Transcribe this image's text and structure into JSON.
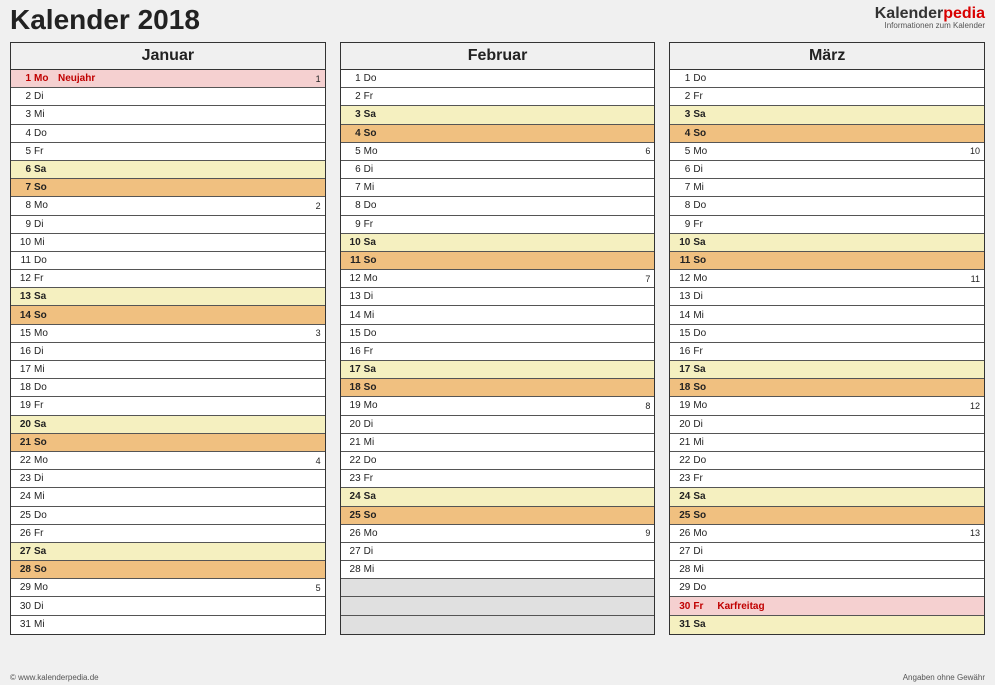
{
  "title": "Kalender 2018",
  "brand": {
    "name1": "Kalender",
    "name2": "pedia",
    "sub": "Informationen zum Kalender"
  },
  "footer": {
    "left": "© www.kalenderpedia.de",
    "right": "Angaben ohne Gewähr"
  },
  "months": [
    {
      "name": "Januar",
      "days": [
        {
          "n": "1",
          "wd": "Mo",
          "note": "Neujahr",
          "wk": "1",
          "cls": "holiday"
        },
        {
          "n": "2",
          "wd": "Di",
          "note": "",
          "wk": "",
          "cls": ""
        },
        {
          "n": "3",
          "wd": "Mi",
          "note": "",
          "wk": "",
          "cls": ""
        },
        {
          "n": "4",
          "wd": "Do",
          "note": "",
          "wk": "",
          "cls": ""
        },
        {
          "n": "5",
          "wd": "Fr",
          "note": "",
          "wk": "",
          "cls": ""
        },
        {
          "n": "6",
          "wd": "Sa",
          "note": "",
          "wk": "",
          "cls": "sat"
        },
        {
          "n": "7",
          "wd": "So",
          "note": "",
          "wk": "",
          "cls": "sun"
        },
        {
          "n": "8",
          "wd": "Mo",
          "note": "",
          "wk": "2",
          "cls": ""
        },
        {
          "n": "9",
          "wd": "Di",
          "note": "",
          "wk": "",
          "cls": ""
        },
        {
          "n": "10",
          "wd": "Mi",
          "note": "",
          "wk": "",
          "cls": ""
        },
        {
          "n": "11",
          "wd": "Do",
          "note": "",
          "wk": "",
          "cls": ""
        },
        {
          "n": "12",
          "wd": "Fr",
          "note": "",
          "wk": "",
          "cls": ""
        },
        {
          "n": "13",
          "wd": "Sa",
          "note": "",
          "wk": "",
          "cls": "sat"
        },
        {
          "n": "14",
          "wd": "So",
          "note": "",
          "wk": "",
          "cls": "sun"
        },
        {
          "n": "15",
          "wd": "Mo",
          "note": "",
          "wk": "3",
          "cls": ""
        },
        {
          "n": "16",
          "wd": "Di",
          "note": "",
          "wk": "",
          "cls": ""
        },
        {
          "n": "17",
          "wd": "Mi",
          "note": "",
          "wk": "",
          "cls": ""
        },
        {
          "n": "18",
          "wd": "Do",
          "note": "",
          "wk": "",
          "cls": ""
        },
        {
          "n": "19",
          "wd": "Fr",
          "note": "",
          "wk": "",
          "cls": ""
        },
        {
          "n": "20",
          "wd": "Sa",
          "note": "",
          "wk": "",
          "cls": "sat"
        },
        {
          "n": "21",
          "wd": "So",
          "note": "",
          "wk": "",
          "cls": "sun"
        },
        {
          "n": "22",
          "wd": "Mo",
          "note": "",
          "wk": "4",
          "cls": ""
        },
        {
          "n": "23",
          "wd": "Di",
          "note": "",
          "wk": "",
          "cls": ""
        },
        {
          "n": "24",
          "wd": "Mi",
          "note": "",
          "wk": "",
          "cls": ""
        },
        {
          "n": "25",
          "wd": "Do",
          "note": "",
          "wk": "",
          "cls": ""
        },
        {
          "n": "26",
          "wd": "Fr",
          "note": "",
          "wk": "",
          "cls": ""
        },
        {
          "n": "27",
          "wd": "Sa",
          "note": "",
          "wk": "",
          "cls": "sat"
        },
        {
          "n": "28",
          "wd": "So",
          "note": "",
          "wk": "",
          "cls": "sun"
        },
        {
          "n": "29",
          "wd": "Mo",
          "note": "",
          "wk": "5",
          "cls": ""
        },
        {
          "n": "30",
          "wd": "Di",
          "note": "",
          "wk": "",
          "cls": ""
        },
        {
          "n": "31",
          "wd": "Mi",
          "note": "",
          "wk": "",
          "cls": ""
        }
      ]
    },
    {
      "name": "Februar",
      "days": [
        {
          "n": "1",
          "wd": "Do",
          "note": "",
          "wk": "",
          "cls": ""
        },
        {
          "n": "2",
          "wd": "Fr",
          "note": "",
          "wk": "",
          "cls": ""
        },
        {
          "n": "3",
          "wd": "Sa",
          "note": "",
          "wk": "",
          "cls": "sat"
        },
        {
          "n": "4",
          "wd": "So",
          "note": "",
          "wk": "",
          "cls": "sun"
        },
        {
          "n": "5",
          "wd": "Mo",
          "note": "",
          "wk": "6",
          "cls": ""
        },
        {
          "n": "6",
          "wd": "Di",
          "note": "",
          "wk": "",
          "cls": ""
        },
        {
          "n": "7",
          "wd": "Mi",
          "note": "",
          "wk": "",
          "cls": ""
        },
        {
          "n": "8",
          "wd": "Do",
          "note": "",
          "wk": "",
          "cls": ""
        },
        {
          "n": "9",
          "wd": "Fr",
          "note": "",
          "wk": "",
          "cls": ""
        },
        {
          "n": "10",
          "wd": "Sa",
          "note": "",
          "wk": "",
          "cls": "sat"
        },
        {
          "n": "11",
          "wd": "So",
          "note": "",
          "wk": "",
          "cls": "sun"
        },
        {
          "n": "12",
          "wd": "Mo",
          "note": "",
          "wk": "7",
          "cls": ""
        },
        {
          "n": "13",
          "wd": "Di",
          "note": "",
          "wk": "",
          "cls": ""
        },
        {
          "n": "14",
          "wd": "Mi",
          "note": "",
          "wk": "",
          "cls": ""
        },
        {
          "n": "15",
          "wd": "Do",
          "note": "",
          "wk": "",
          "cls": ""
        },
        {
          "n": "16",
          "wd": "Fr",
          "note": "",
          "wk": "",
          "cls": ""
        },
        {
          "n": "17",
          "wd": "Sa",
          "note": "",
          "wk": "",
          "cls": "sat"
        },
        {
          "n": "18",
          "wd": "So",
          "note": "",
          "wk": "",
          "cls": "sun"
        },
        {
          "n": "19",
          "wd": "Mo",
          "note": "",
          "wk": "8",
          "cls": ""
        },
        {
          "n": "20",
          "wd": "Di",
          "note": "",
          "wk": "",
          "cls": ""
        },
        {
          "n": "21",
          "wd": "Mi",
          "note": "",
          "wk": "",
          "cls": ""
        },
        {
          "n": "22",
          "wd": "Do",
          "note": "",
          "wk": "",
          "cls": ""
        },
        {
          "n": "23",
          "wd": "Fr",
          "note": "",
          "wk": "",
          "cls": ""
        },
        {
          "n": "24",
          "wd": "Sa",
          "note": "",
          "wk": "",
          "cls": "sat"
        },
        {
          "n": "25",
          "wd": "So",
          "note": "",
          "wk": "",
          "cls": "sun"
        },
        {
          "n": "26",
          "wd": "Mo",
          "note": "",
          "wk": "9",
          "cls": ""
        },
        {
          "n": "27",
          "wd": "Di",
          "note": "",
          "wk": "",
          "cls": ""
        },
        {
          "n": "28",
          "wd": "Mi",
          "note": "",
          "wk": "",
          "cls": ""
        },
        {
          "n": "",
          "wd": "",
          "note": "",
          "wk": "",
          "cls": "blank"
        },
        {
          "n": "",
          "wd": "",
          "note": "",
          "wk": "",
          "cls": "blank"
        },
        {
          "n": "",
          "wd": "",
          "note": "",
          "wk": "",
          "cls": "blank"
        }
      ]
    },
    {
      "name": "März",
      "days": [
        {
          "n": "1",
          "wd": "Do",
          "note": "",
          "wk": "",
          "cls": ""
        },
        {
          "n": "2",
          "wd": "Fr",
          "note": "",
          "wk": "",
          "cls": ""
        },
        {
          "n": "3",
          "wd": "Sa",
          "note": "",
          "wk": "",
          "cls": "sat"
        },
        {
          "n": "4",
          "wd": "So",
          "note": "",
          "wk": "",
          "cls": "sun"
        },
        {
          "n": "5",
          "wd": "Mo",
          "note": "",
          "wk": "10",
          "cls": ""
        },
        {
          "n": "6",
          "wd": "Di",
          "note": "",
          "wk": "",
          "cls": ""
        },
        {
          "n": "7",
          "wd": "Mi",
          "note": "",
          "wk": "",
          "cls": ""
        },
        {
          "n": "8",
          "wd": "Do",
          "note": "",
          "wk": "",
          "cls": ""
        },
        {
          "n": "9",
          "wd": "Fr",
          "note": "",
          "wk": "",
          "cls": ""
        },
        {
          "n": "10",
          "wd": "Sa",
          "note": "",
          "wk": "",
          "cls": "sat"
        },
        {
          "n": "11",
          "wd": "So",
          "note": "",
          "wk": "",
          "cls": "sun"
        },
        {
          "n": "12",
          "wd": "Mo",
          "note": "",
          "wk": "11",
          "cls": ""
        },
        {
          "n": "13",
          "wd": "Di",
          "note": "",
          "wk": "",
          "cls": ""
        },
        {
          "n": "14",
          "wd": "Mi",
          "note": "",
          "wk": "",
          "cls": ""
        },
        {
          "n": "15",
          "wd": "Do",
          "note": "",
          "wk": "",
          "cls": ""
        },
        {
          "n": "16",
          "wd": "Fr",
          "note": "",
          "wk": "",
          "cls": ""
        },
        {
          "n": "17",
          "wd": "Sa",
          "note": "",
          "wk": "",
          "cls": "sat"
        },
        {
          "n": "18",
          "wd": "So",
          "note": "",
          "wk": "",
          "cls": "sun"
        },
        {
          "n": "19",
          "wd": "Mo",
          "note": "",
          "wk": "12",
          "cls": ""
        },
        {
          "n": "20",
          "wd": "Di",
          "note": "",
          "wk": "",
          "cls": ""
        },
        {
          "n": "21",
          "wd": "Mi",
          "note": "",
          "wk": "",
          "cls": ""
        },
        {
          "n": "22",
          "wd": "Do",
          "note": "",
          "wk": "",
          "cls": ""
        },
        {
          "n": "23",
          "wd": "Fr",
          "note": "",
          "wk": "",
          "cls": ""
        },
        {
          "n": "24",
          "wd": "Sa",
          "note": "",
          "wk": "",
          "cls": "sat"
        },
        {
          "n": "25",
          "wd": "So",
          "note": "",
          "wk": "",
          "cls": "sun"
        },
        {
          "n": "26",
          "wd": "Mo",
          "note": "",
          "wk": "13",
          "cls": ""
        },
        {
          "n": "27",
          "wd": "Di",
          "note": "",
          "wk": "",
          "cls": ""
        },
        {
          "n": "28",
          "wd": "Mi",
          "note": "",
          "wk": "",
          "cls": ""
        },
        {
          "n": "29",
          "wd": "Do",
          "note": "",
          "wk": "",
          "cls": ""
        },
        {
          "n": "30",
          "wd": "Fr",
          "note": "Karfreitag",
          "wk": "",
          "cls": "holiday"
        },
        {
          "n": "31",
          "wd": "Sa",
          "note": "",
          "wk": "",
          "cls": "sat"
        }
      ]
    }
  ]
}
